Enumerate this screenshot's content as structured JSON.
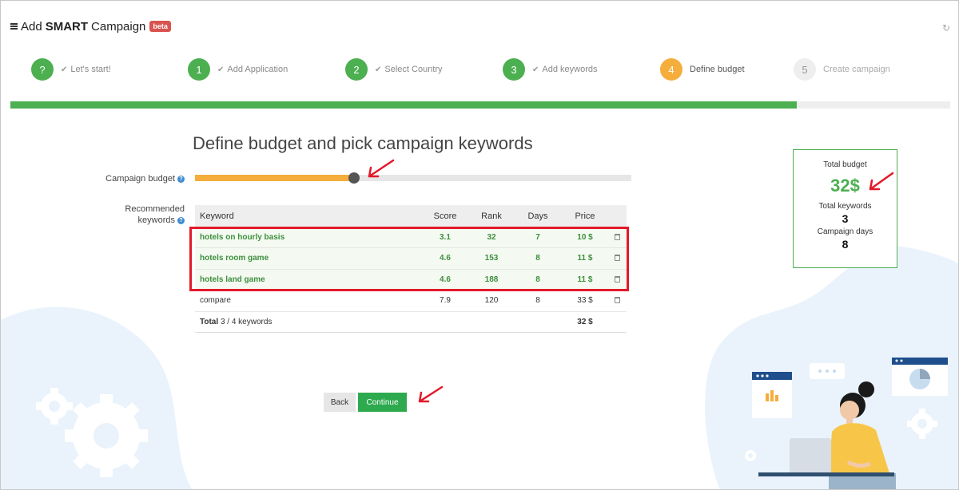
{
  "header": {
    "prefix": "Add",
    "bold": "SMART",
    "suffix": "Campaign",
    "badge": "beta"
  },
  "steps": [
    {
      "num": "?",
      "label": "Let's start!",
      "state": "done"
    },
    {
      "num": "1",
      "label": "Add Application",
      "state": "done"
    },
    {
      "num": "2",
      "label": "Select Country",
      "state": "done"
    },
    {
      "num": "3",
      "label": "Add keywords",
      "state": "done"
    },
    {
      "num": "4",
      "label": "Define budget",
      "state": "current"
    },
    {
      "num": "5",
      "label": "Create campaign",
      "state": "todo"
    }
  ],
  "progress_fraction": 0.837,
  "page_title": "Define budget and pick campaign keywords",
  "budget": {
    "label": "Campaign budget",
    "slider_fraction": 0.365
  },
  "keywords": {
    "label_line1": "Recommended",
    "label_line2": "keywords",
    "columns": [
      "Keyword",
      "Score",
      "Rank",
      "Days",
      "Price"
    ],
    "rows": [
      {
        "keyword": "hotels on hourly basis",
        "score": "3.1",
        "rank": "32",
        "days": "7",
        "price": "10 $",
        "selected": true
      },
      {
        "keyword": "hotels room game",
        "score": "4.6",
        "rank": "153",
        "days": "8",
        "price": "11 $",
        "selected": true
      },
      {
        "keyword": "hotels land game",
        "score": "4.6",
        "rank": "188",
        "days": "8",
        "price": "11 $",
        "selected": true
      },
      {
        "keyword": "compare",
        "score": "7.9",
        "rank": "120",
        "days": "8",
        "price": "33 $",
        "selected": false
      }
    ],
    "total_label": "Total",
    "total_count": "3 / 4 keywords",
    "total_price": "32 $"
  },
  "summary": {
    "total_budget_label": "Total budget",
    "total_budget": "32$",
    "total_keywords_label": "Total keywords",
    "total_keywords": "3",
    "campaign_days_label": "Campaign days",
    "campaign_days": "8"
  },
  "buttons": {
    "back": "Back",
    "continue": "Continue"
  },
  "colors": {
    "green": "#4caf50",
    "orange": "#f5ad3c",
    "red_annotation": "#e3192a",
    "button_green": "#2eaa4e"
  }
}
